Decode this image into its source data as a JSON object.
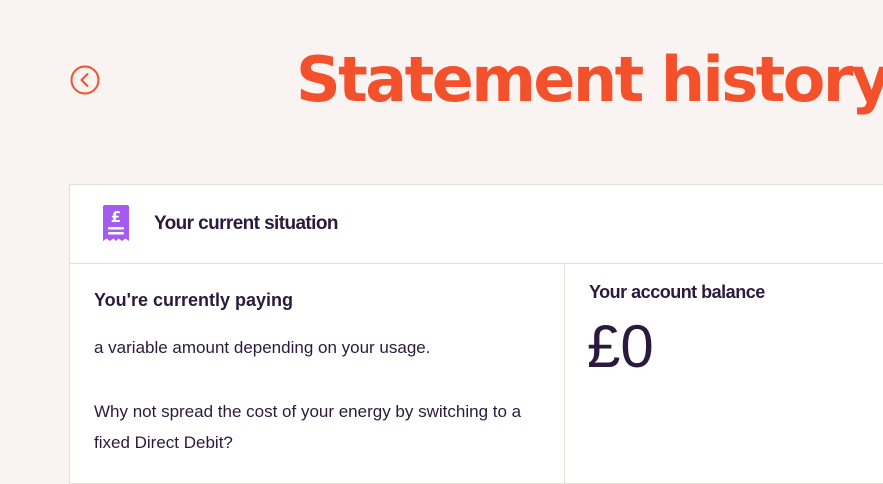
{
  "header": {
    "title": "Statement history",
    "back_icon": "chevron-left-circle-icon"
  },
  "colors": {
    "background": "#f9f4f1",
    "accent_orange": "#f3512c",
    "icon_purple": "#a45cf0",
    "text_dark": "#2b1a3d",
    "border": "#e4dedb"
  },
  "situation_card": {
    "icon": "receipt-pound-icon",
    "title": "Your current situation",
    "paying": {
      "heading": "You're currently paying",
      "description": "a variable amount depending on your usage.",
      "promo": "Why not spread the cost of your energy by switching to a fixed Direct Debit?"
    },
    "balance": {
      "label": "Your account balance",
      "value": "£0"
    }
  }
}
